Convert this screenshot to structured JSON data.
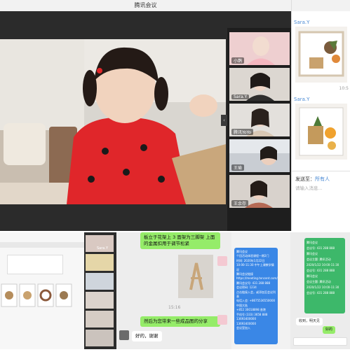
{
  "window": {
    "title": "腾讯会议"
  },
  "participants": [
    {
      "name": "小鹊"
    },
    {
      "name": "Sara.Y"
    },
    {
      "name": "腾讯YoYo"
    },
    {
      "name": "王瑜"
    },
    {
      "name": "王余存"
    }
  ],
  "chat": {
    "messages": [
      {
        "sender": "Sara.Y",
        "time": "10:5"
      },
      {
        "sender": "Sara.Y"
      }
    ],
    "send_to_label": "发送至：",
    "send_to_value": "所有人",
    "input_placeholder": "请输入消息..."
  },
  "bottom_chat": {
    "msg1": "板立于花架上 3 面架为三脚架 上面的金属扣用于调节松紧",
    "time": "15:16",
    "msg2": "然后为您带来一些成品图的分享",
    "msg3": "好的，谢谢",
    "thumb_label": "Sara.Y"
  },
  "bottom_right": {
    "left_card_lines": [
      "腾讯会议",
      "个回活动体验课程一期2门",
      "时间: 2020年1月22日",
      "10:00-11:30 中午上课教学情况",
      "腾讯会议链接",
      "https://meeting.tencent.com/s/NbqN4S0K8f",
      "腾讯会议号: 431 288 888",
      "会议密码: 1234",
      "点击链接入会，或添加至会议列表",
      "电话入会: +8675536550000",
      "中国大陆",
      "+852 30018898 香港",
      "手机号 (333) 3658 888",
      "13693400000 13693400000",
      "会议室加入"
    ],
    "right_card_lines": [
      "腾讯会议",
      "会议号: 431 288 888",
      "腾讯会议",
      "会议主题: 腾讯活动",
      "2020/1/22 10:00-11:30",
      "会议号: 431 288 888",
      "腾讯会议",
      "会议主题: 腾讯活动",
      "2020/1/22 10:00-11:30",
      "会议号: 431 288 888"
    ],
    "reply": "收到，明天见",
    "reply2": "好的"
  }
}
